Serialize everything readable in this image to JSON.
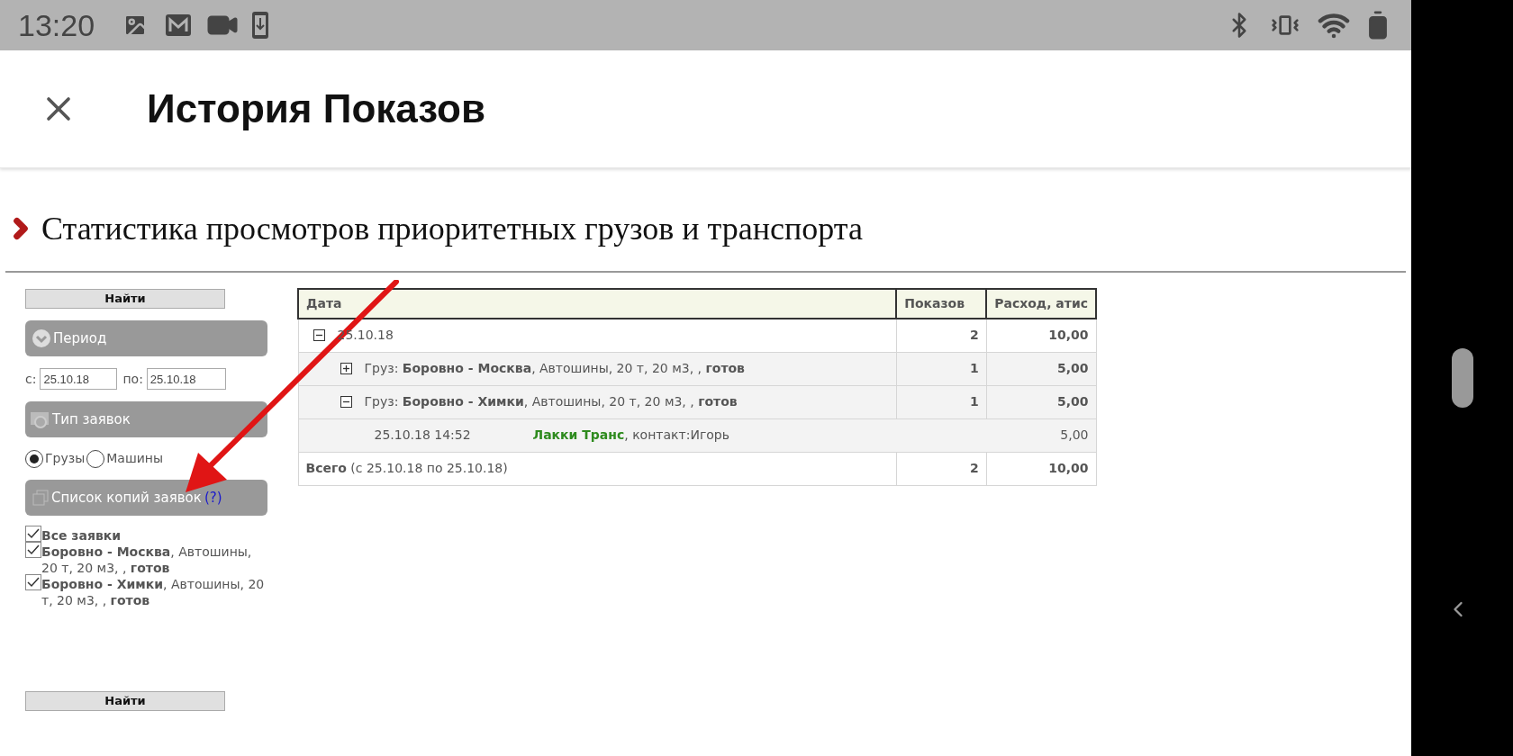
{
  "status_bar": {
    "time": "13:20"
  },
  "app_bar": {
    "title": "История Показов"
  },
  "section": {
    "title": "Статистика просмотров приоритетных грузов и транспорта"
  },
  "filters": {
    "search_button_top": "Найти",
    "period": {
      "title": "Период",
      "from_label": "с:",
      "from": "25.10.18",
      "to_label": "по:",
      "to": "25.10.18"
    },
    "type": {
      "title": "Тип заявок",
      "options": [
        {
          "label": "Грузы",
          "selected": true
        },
        {
          "label": "Машины",
          "selected": false
        }
      ]
    },
    "copies": {
      "title": "Список копий заявок",
      "help": "(?)",
      "items": [
        {
          "text": "**Все заявки**",
          "checked": true
        },
        {
          "text": "**Боровно - Москва**, Автошины, 20 т, 20 м3, , **готов**",
          "checked": true
        },
        {
          "text": "**Боровно - Химки**, Автошины, 20 т, 20 м3, , **готов**",
          "checked": true
        }
      ]
    },
    "search_button_bottom": "Найти"
  },
  "table": {
    "columns": [
      "Дата",
      "Показов",
      "Расход, атис"
    ],
    "rows": [
      {
        "kind": "group",
        "label": "25.10.18",
        "expanded": true,
        "views": "2",
        "cost": "10,00",
        "children": [
          {
            "kind": "cargo",
            "label": "Груз: **Боровно - Москва**, Автошины, 20 т, 20 м3, , **готов**",
            "expanded": false,
            "views": "1",
            "cost": "5,00"
          },
          {
            "kind": "cargo",
            "label": "Груз: **Боровно - Химки**, Автошины, 20 т, 20 м3, , **готов**",
            "expanded": true,
            "views": "1",
            "cost": "5,00",
            "children": [
              {
                "kind": "detail",
                "time": "25.10.18 14:52",
                "company": "Лакки Транс",
                "contact": ", контакт:Игорь",
                "cost": "5,00"
              }
            ]
          }
        ]
      }
    ],
    "total": {
      "label": "**Всего** (с 25.10.18 по 25.10.18)",
      "views": "2",
      "cost": "10,00"
    }
  }
}
